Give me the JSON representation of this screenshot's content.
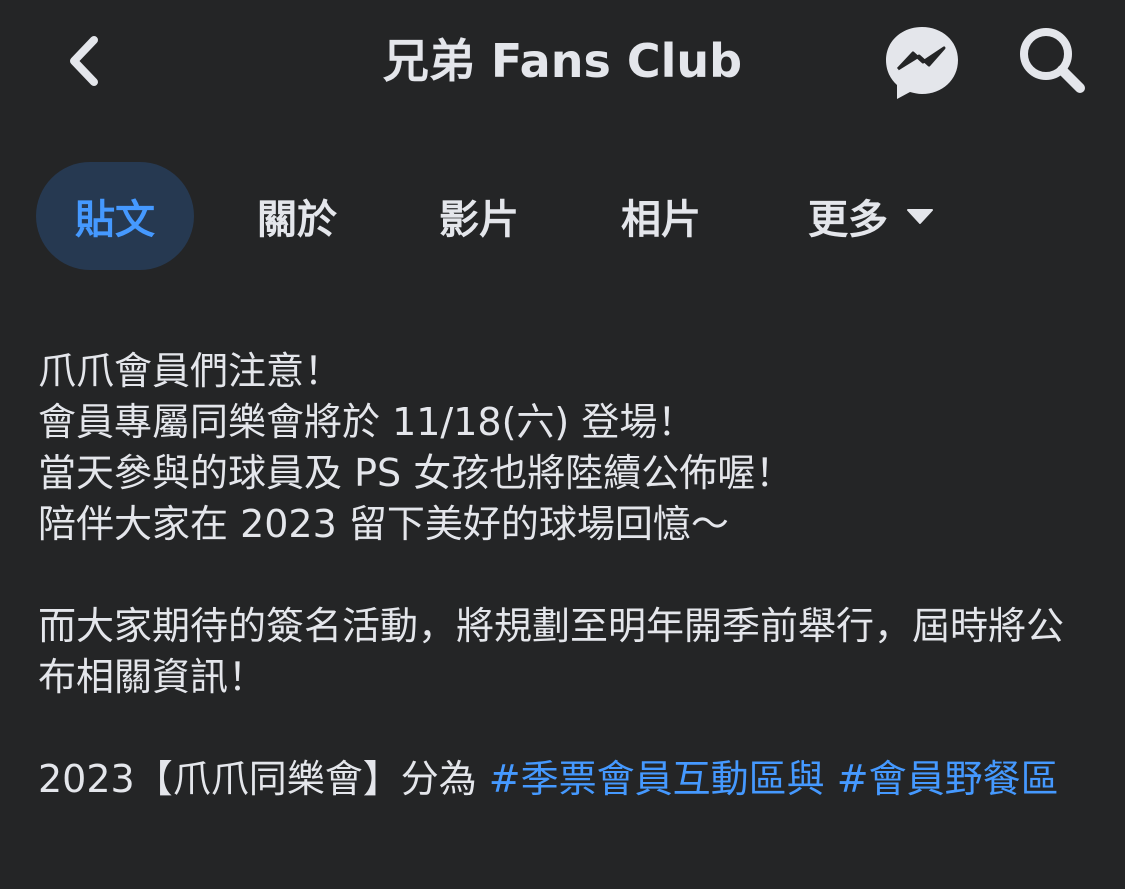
{
  "header": {
    "title": "兄弟 Fans Club",
    "back_icon": "chevron-left-icon",
    "messenger_icon": "messenger-icon",
    "search_icon": "search-icon"
  },
  "tabs": [
    {
      "label": "貼文",
      "active": true
    },
    {
      "label": "關於",
      "active": false
    },
    {
      "label": "影片",
      "active": false
    },
    {
      "label": "相片",
      "active": false
    },
    {
      "label": "更多",
      "active": false
    }
  ],
  "post": {
    "lines": [
      "爪爪會員們注意！",
      "會員專屬同樂會將於 11/18(六) 登場！",
      "當天參與的球員及 PS 女孩也將陸續公佈喔！",
      "陪伴大家在 2023 留下美好的球場回憶～"
    ],
    "paragraph2": "而大家期待的簽名活動，將規劃至明年開季前舉行，屆時將公布相關資訊！",
    "paragraph3_prefix": "2023【爪爪同樂會】分為 ",
    "hashtag1": "#季票會員互動區與",
    "hashtag2": "#會員野餐區"
  },
  "colors": {
    "background": "#242526",
    "text": "#e4e6eb",
    "accent": "#4599ff",
    "active_tab_bg": "#263951"
  }
}
